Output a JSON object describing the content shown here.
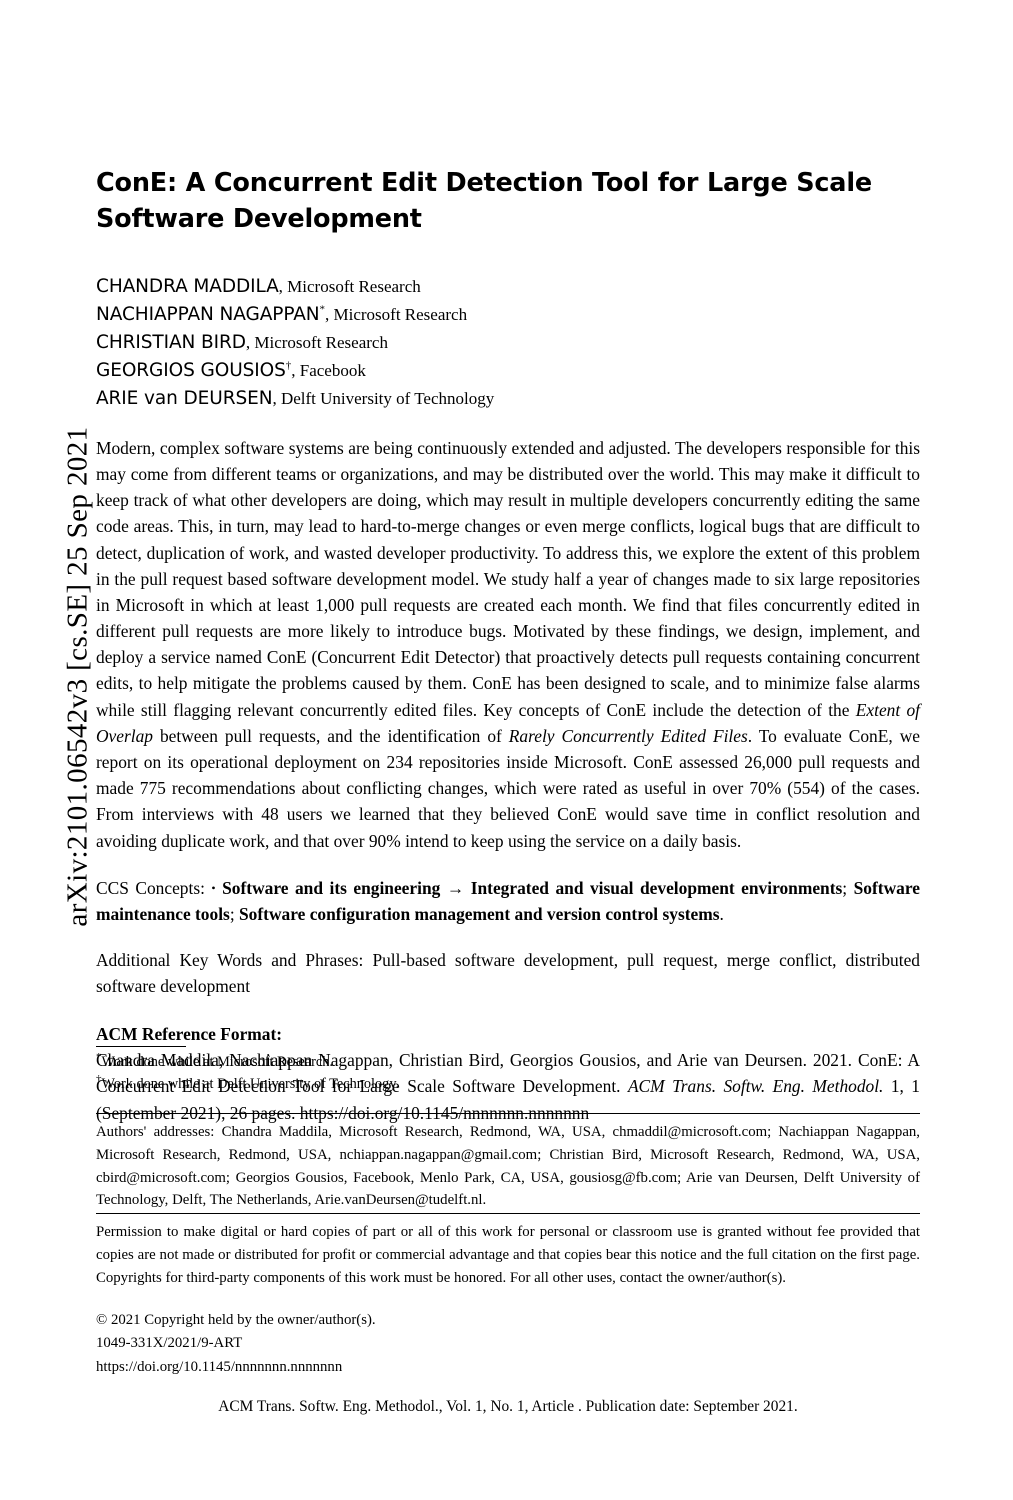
{
  "arxiv": {
    "stamp": "arXiv:2101.06542v3  [cs.SE]  25 Sep 2021"
  },
  "title": {
    "line1": "ConE: A Concurrent Edit Detection Tool for Large Scale",
    "line2": "Software Development"
  },
  "authors": [
    {
      "name": "CHANDRA MADDILA",
      "mark": "",
      "affiliation": "Microsoft Research"
    },
    {
      "name": "NACHIAPPAN NAGAPPAN",
      "mark": "*",
      "affiliation": "Microsoft Research"
    },
    {
      "name": "CHRISTIAN BIRD",
      "mark": "",
      "affiliation": "Microsoft Research"
    },
    {
      "name": "GEORGIOS GOUSIOS",
      "mark": "†",
      "affiliation": "Facebook"
    },
    {
      "name": "ARIE van DEURSEN",
      "mark": "",
      "affiliation": "Delft University of Technology"
    }
  ],
  "abstract": {
    "part1": "Modern, complex software systems are being continuously extended and adjusted. The developers responsible for this may come from different teams or organizations, and may be distributed over the world. This may make it difficult to keep track of what other developers are doing, which may result in multiple developers concurrently editing the same code areas. This, in turn, may lead to hard-to-merge changes or even merge conflicts, logical bugs that are difficult to detect, duplication of work, and wasted developer productivity. To address this, we explore the extent of this problem in the pull request based software development model. We study half a year of changes made to six large repositories in Microsoft in which at least 1,000 pull requests are created each month. We find that files concurrently edited in different pull requests are more likely to introduce bugs. Motivated by these findings, we design, implement, and deploy a service named ConE (Concurrent Edit Detector) that proactively detects pull requests containing concurrent edits, to help mitigate the problems caused by them. ConE has been designed to scale, and to minimize false alarms while still flagging relevant concurrently edited files. Key concepts of ConE include the detection of the ",
    "italic1": "Extent of Overlap",
    "part2": " between pull requests, and the identification of ",
    "italic2": "Rarely Concurrently Edited Files",
    "part3": ". To evaluate ConE, we report on its operational deployment on 234 repositories inside Microsoft. ConE assessed 26,000 pull requests and made 775 recommendations about conflicting changes, which were rated as useful in over 70% (554) of the cases. From interviews with 48 users we learned that they believed ConE would save time in conflict resolution and avoiding duplicate work, and that over 90% intend to keep using the service on a daily basis."
  },
  "ccs": {
    "label": "CCS Concepts:",
    "bullet": "•",
    "bold1": "Software and its engineering",
    "arrow": "→",
    "bold2": "Integrated and visual development environments",
    "sep1": ";",
    "bold3": "Software maintenance tools",
    "sep2": ";",
    "bold4": "Software configuration management and version control systems",
    "end": "."
  },
  "keywords": {
    "label": "Additional Key Words and Phrases:",
    "text": "Pull-based software development, pull request, merge conflict, distributed software development"
  },
  "reference_format": {
    "heading": "ACM Reference Format:",
    "part1": "Chandra Maddila, Nachiappan Nagappan, Christian Bird, Georgios Gousios, and Arie van Deursen. 2021. ConE: A Concurrent Edit Detection Tool for Large Scale Software Development. ",
    "journal_italic": "ACM Trans. Softw. Eng. Methodol.",
    "part2": " 1, 1 (September 2021), 26 pages. https://doi.org/10.1145/nnnnnnn.nnnnnnn"
  },
  "footnotes": [
    {
      "mark": "*",
      "text": "Work done while at Microsoft Research."
    },
    {
      "mark": "†",
      "text": "Work done while at Delft University of Technology."
    }
  ],
  "authors_addresses": "Authors' addresses: Chandra Maddila, Microsoft Research, Redmond, WA, USA, chmaddil@microsoft.com; Nachiappan Nagappan, Microsoft Research, Redmond, USA, nchiappan.nagappan@gmail.com; Christian Bird, Microsoft Research, Redmond, WA, USA, cbird@microsoft.com; Georgios Gousios, Facebook, Menlo Park, CA, USA, gousiosg@fb.com; Arie van Deursen, Delft University of Technology, Delft, The Netherlands, Arie.vanDeursen@tudelft.nl.",
  "permission": "Permission to make digital or hard copies of part or all of this work for personal or classroom use is granted without fee provided that copies are not made or distributed for profit or commercial advantage and that copies bear this notice and the full citation on the first page. Copyrights for third-party components of this work must be honored. For all other uses, contact the owner/author(s).",
  "copyright": {
    "line1": "© 2021 Copyright held by the owner/author(s).",
    "line2": "1049-331X/2021/9-ART",
    "line3": "https://doi.org/10.1145/nnnnnnn.nnnnnnn"
  },
  "page_footer": "ACM Trans. Softw. Eng. Methodol., Vol. 1, No. 1, Article . Publication date: September 2021."
}
